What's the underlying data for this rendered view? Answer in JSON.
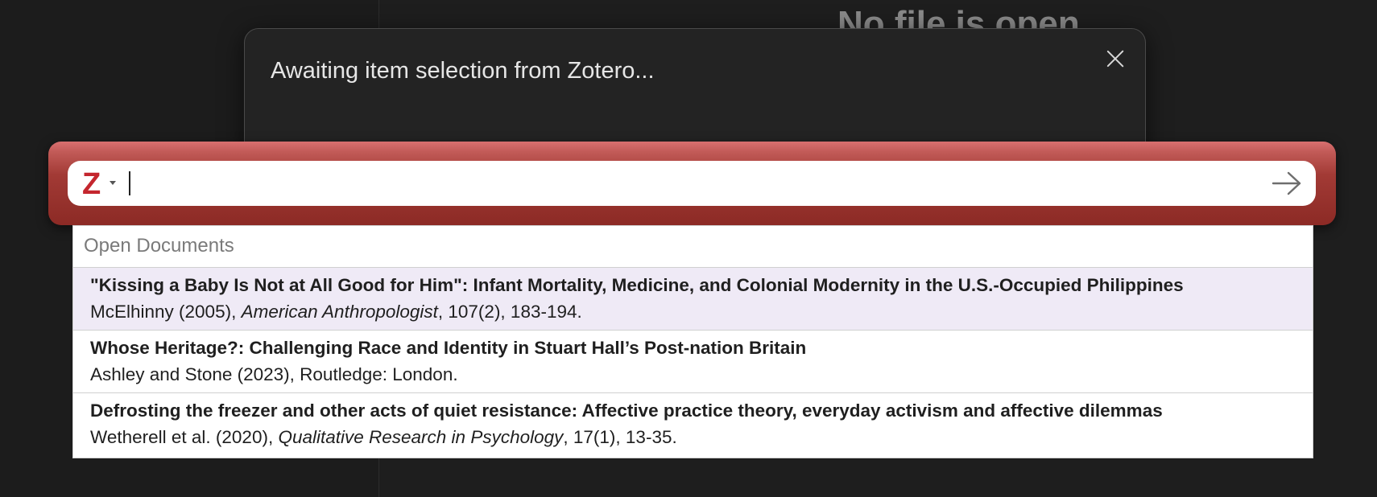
{
  "background": {
    "empty_state_title": "No file is open"
  },
  "modal": {
    "title": "Awaiting item selection from Zotero..."
  },
  "quick_format": {
    "logo": "zotero-z-icon",
    "search_value": "",
    "go_icon": "arrow-right-icon",
    "accent_color": "#a23a35"
  },
  "results": {
    "section_title": "Open Documents",
    "items": [
      {
        "title": "\"Kissing a Baby Is Not at All Good for Him\": Infant Mortality, Medicine, and Colonial Modernity in the U.S.-Occupied Philippines",
        "authors_year": "McElhinny (2005), ",
        "source": "American Anthropologist",
        "details": ", 107(2), 183-194.",
        "selected": true
      },
      {
        "title": "Whose Heritage?: Challenging Race and Identity in Stuart Hall’s Post-nation Britain",
        "authors_year": "Ashley and Stone (2023), Routledge: London.",
        "source": "",
        "details": "",
        "selected": false
      },
      {
        "title": "Defrosting the freezer and other acts of quiet resistance: Affective practice theory, everyday activism and affective dilemmas",
        "authors_year": "Wetherell et al. (2020), ",
        "source": "Qualitative Research in Psychology",
        "details": ", 17(1), 13-35.",
        "selected": false
      }
    ]
  }
}
